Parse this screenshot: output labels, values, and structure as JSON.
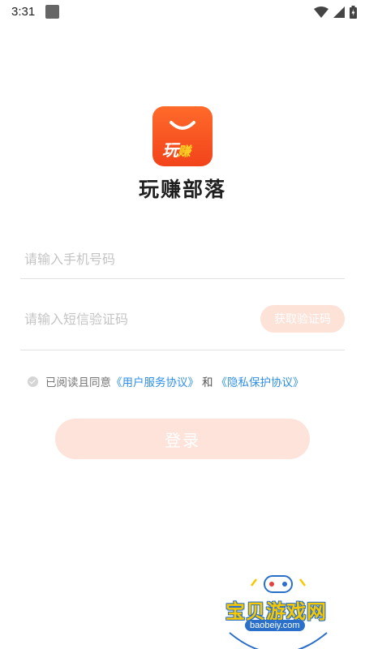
{
  "status_bar": {
    "time": "3:31",
    "icons": [
      "notification-square-icon",
      "wifi-icon",
      "signal-icon",
      "battery-icon"
    ]
  },
  "app": {
    "logo_text_main": "玩",
    "logo_text_accent": "赚",
    "name": "玩赚部落",
    "brand_color": "#f2431b"
  },
  "form": {
    "phone_placeholder": "请输入手机号码",
    "phone_value": "",
    "code_placeholder": "请输入短信验证码",
    "code_value": "",
    "get_code_label": "获取验证码"
  },
  "agreement": {
    "checked": true,
    "prefix": "已阅读且同意",
    "service_link": "《用户服务协议》",
    "and_text": "和",
    "privacy_link": "《隐私保护协议》"
  },
  "login_label": "登录",
  "watermark": {
    "title": "宝贝游戏网",
    "url": "baobeiy.com"
  },
  "colors": {
    "link": "#2f8fe8",
    "button_disabled": "#fde3da",
    "watermark_yellow": "#f5c800",
    "watermark_blue": "#2a6fc9"
  }
}
